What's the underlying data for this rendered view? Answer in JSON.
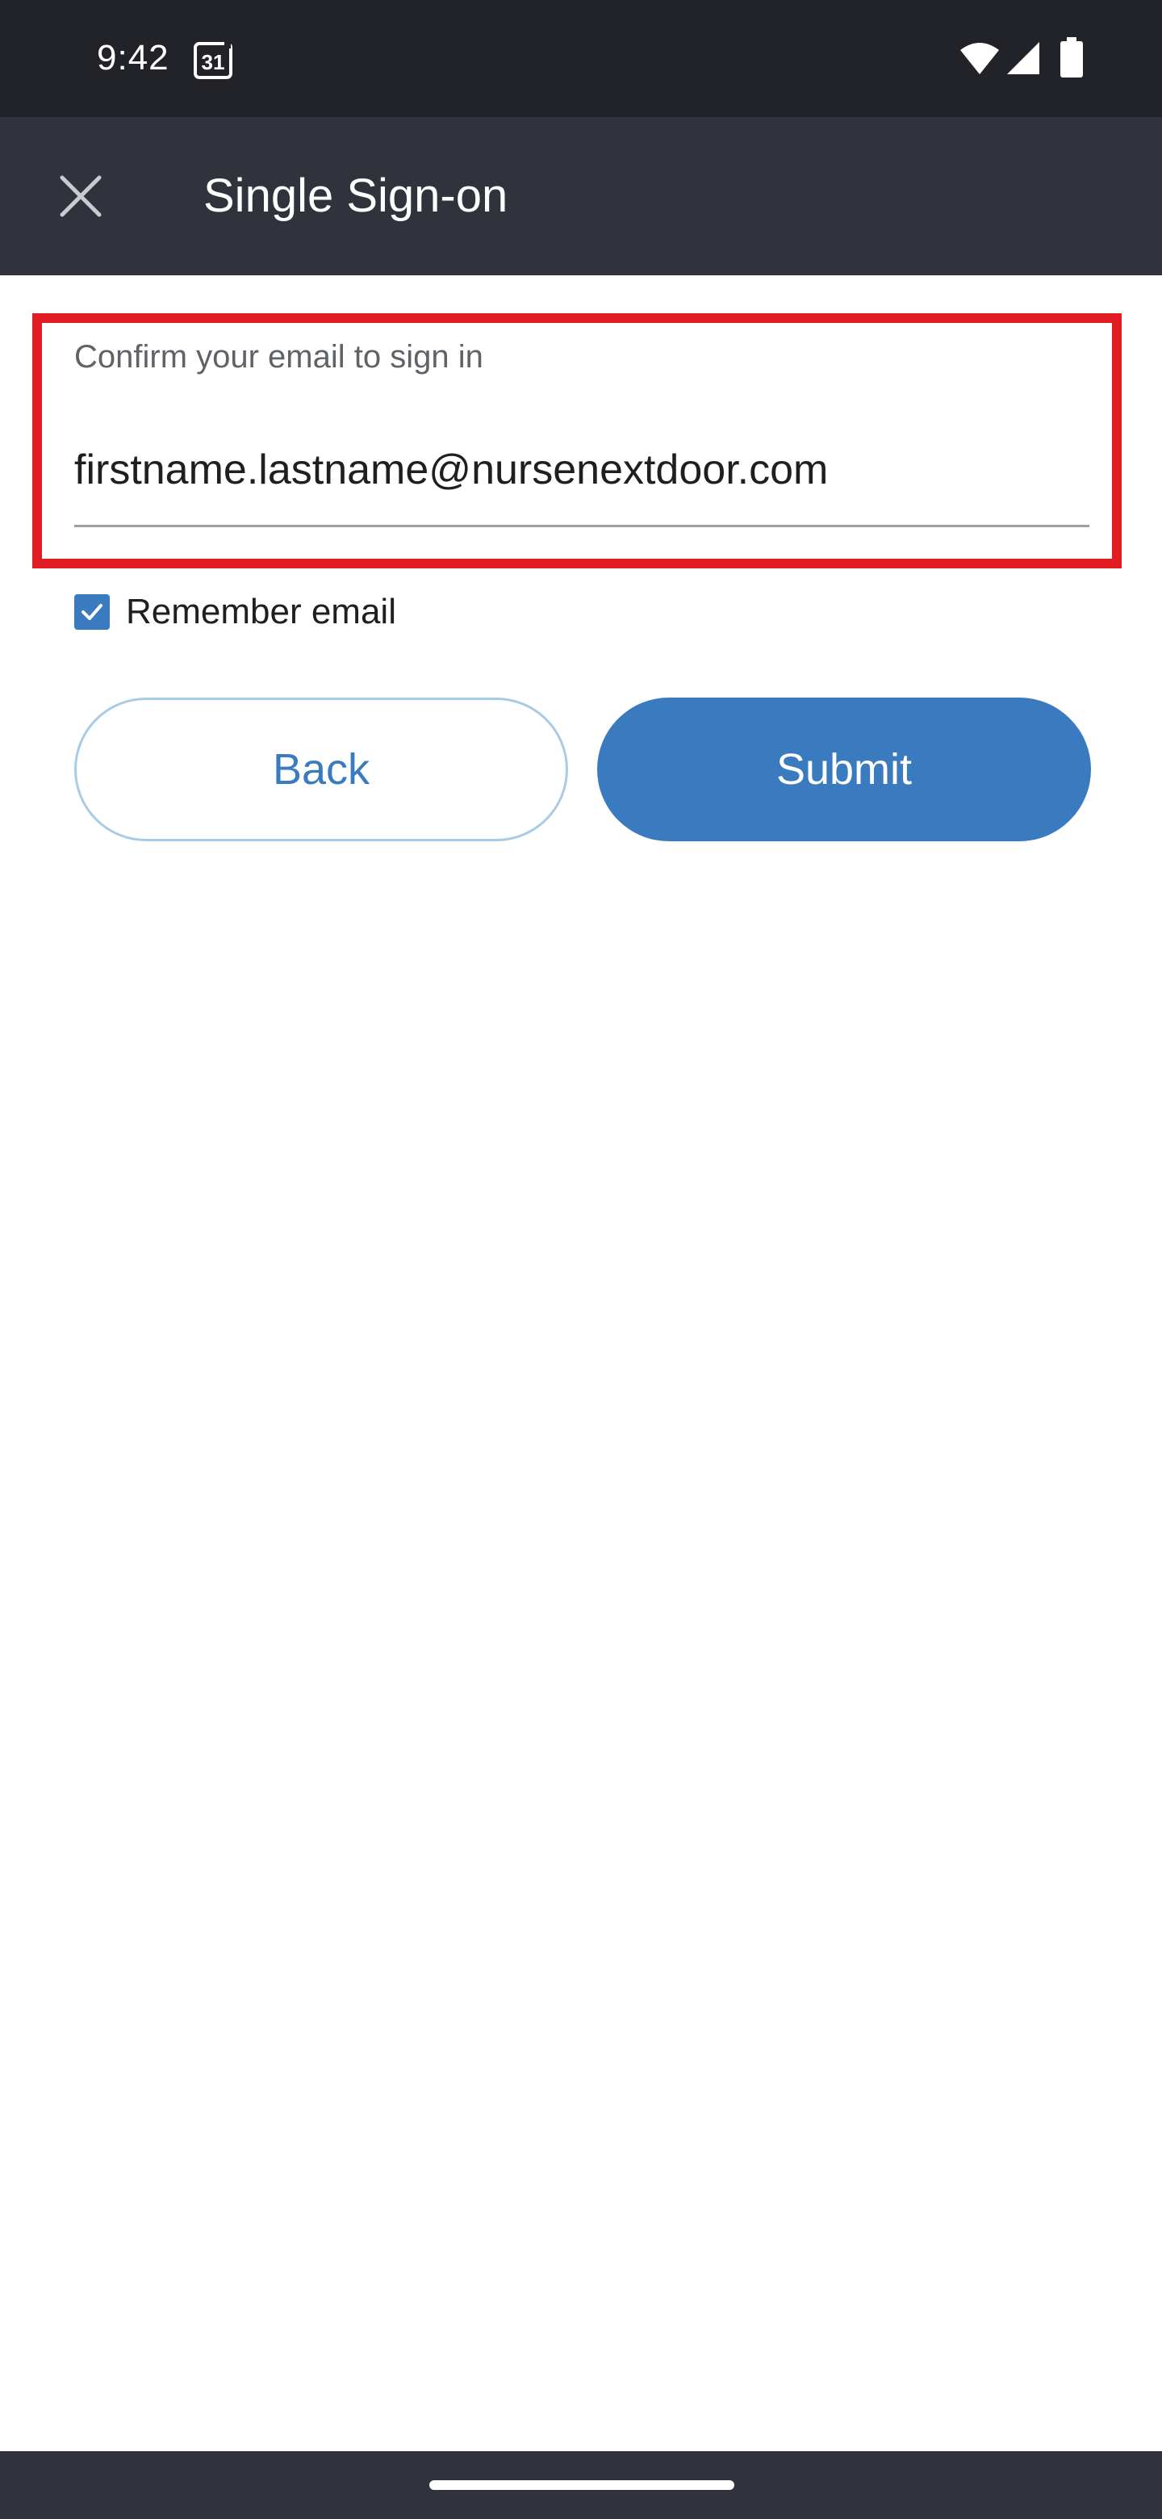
{
  "status_bar": {
    "time": "9:42",
    "calendar_day": "31"
  },
  "app_bar": {
    "title": "Single Sign-on"
  },
  "form": {
    "email_label": "Confirm your email to sign in",
    "email_value": "firstname.lastname@nursenextdoor.com",
    "remember_email_label": "Remember email",
    "remember_email_checked": true
  },
  "actions": {
    "back_label": "Back",
    "submit_label": "Submit"
  },
  "colors": {
    "accent": "#3a7abf",
    "highlight": "#e11b22",
    "app_bar": "#30333b",
    "status_bar": "#222329"
  },
  "icons": {
    "close": "close-icon",
    "calendar": "calendar-icon",
    "wifi": "wifi-icon",
    "signal": "signal-icon",
    "battery": "battery-icon",
    "checkmark": "checkmark-icon"
  }
}
